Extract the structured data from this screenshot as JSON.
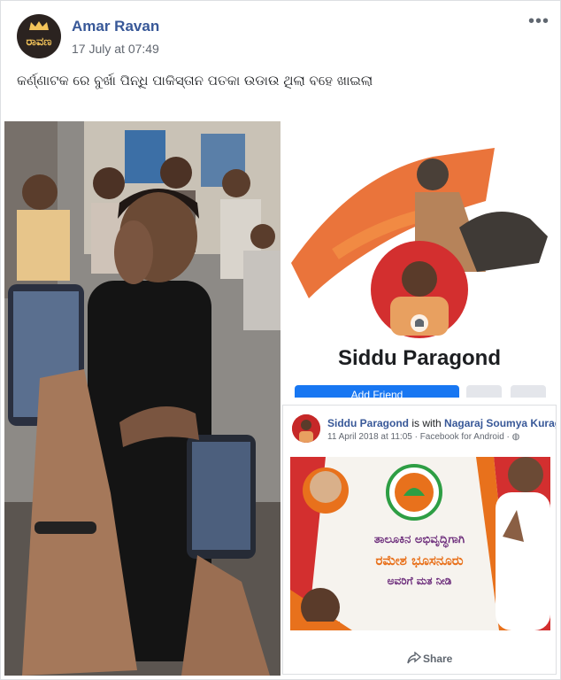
{
  "post": {
    "author": "Amar Ravan",
    "timestamp": "17 July at 07:49",
    "avatar_text": "ರಾವಣ",
    "more_label": "•••",
    "caption": "କର୍ଣ୍ଣାଟକ ରେ ବୁର୍ଖା ପିନ୍ଧି ପାକିସ୍ତାନ ପତକା ଉଡାଉ ଥିଲା ବହେ ଖାଇଲା"
  },
  "profile_card": {
    "name": "Siddu Paragond",
    "add_friend_label": "Add Friend"
  },
  "shared_post": {
    "author": "Siddu Paragond",
    "with_text": " is with ",
    "tagged": "Nagaraj Soumya Kurag",
    "meta": "11 April 2018 at 11:05 · Facebook for Android · ◍",
    "banner_line1": "ತಾಲೂಕಿನ ಅಭಿವೃದ್ಧಿಗಾಗಿ",
    "banner_line2": "ರಮೇಶ ಭೂಸನೂರು",
    "banner_line3": "ಅವರಿಗೆ ಮತ ನೀಡಿ",
    "share_label": "Share"
  },
  "colors": {
    "link": "#385898",
    "facebook_blue": "#1877f2",
    "saffron": "#e8711c"
  }
}
